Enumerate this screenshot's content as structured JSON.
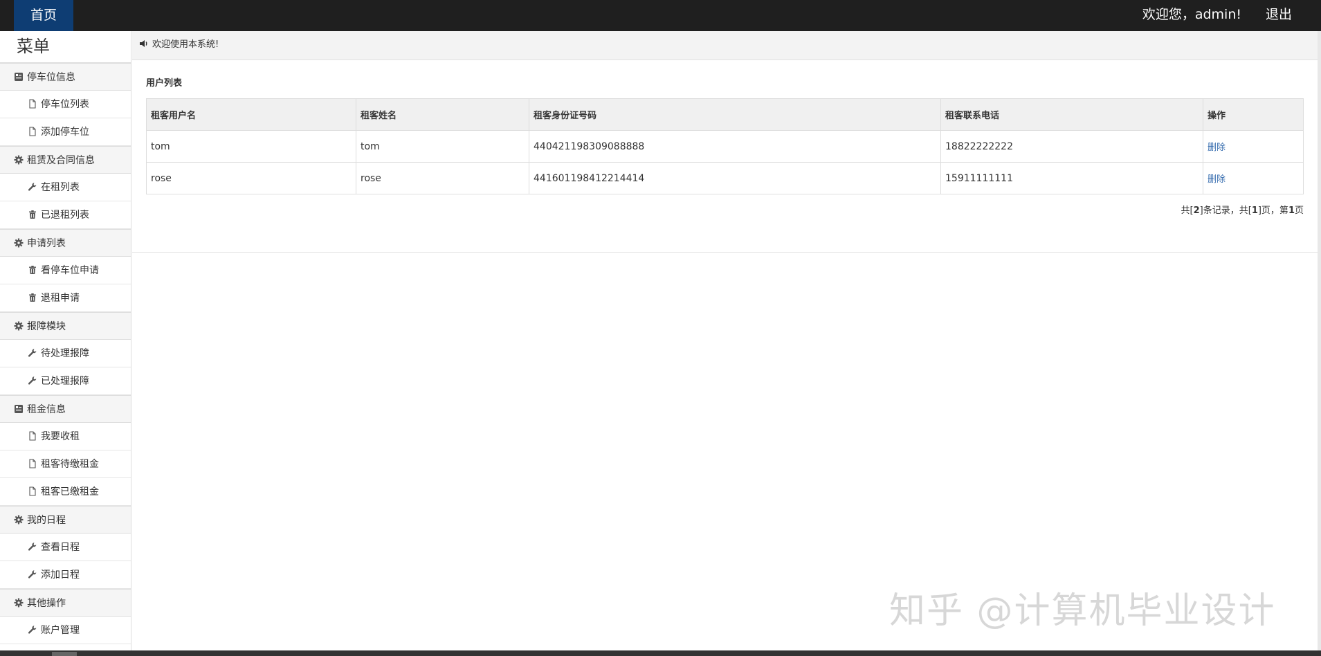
{
  "topbar": {
    "home": "首页",
    "welcome": "欢迎您，admin!",
    "logout": "退出"
  },
  "sidebar": {
    "title": "菜单",
    "groups": [
      {
        "label": "停车位信息",
        "icon": "list-icon",
        "items": [
          {
            "label": "停车位列表",
            "icon": "file-icon"
          },
          {
            "label": "添加停车位",
            "icon": "file-icon"
          }
        ]
      },
      {
        "label": "租赁及合同信息",
        "icon": "gear-icon",
        "items": [
          {
            "label": "在租列表",
            "icon": "wrench-icon"
          },
          {
            "label": "已退租列表",
            "icon": "trash-icon"
          }
        ]
      },
      {
        "label": "申请列表",
        "icon": "gear-icon",
        "items": [
          {
            "label": "看停车位申请",
            "icon": "trash-icon"
          },
          {
            "label": "退租申请",
            "icon": "trash-icon"
          }
        ]
      },
      {
        "label": "报障模块",
        "icon": "gear-icon",
        "items": [
          {
            "label": "待处理报障",
            "icon": "wrench-icon"
          },
          {
            "label": "已处理报障",
            "icon": "wrench-icon"
          }
        ]
      },
      {
        "label": "租金信息",
        "icon": "list-icon",
        "items": [
          {
            "label": "我要收租",
            "icon": "file-icon"
          },
          {
            "label": "租客待缴租金",
            "icon": "file-icon"
          },
          {
            "label": "租客已缴租金",
            "icon": "file-icon"
          }
        ]
      },
      {
        "label": "我的日程",
        "icon": "gear-icon",
        "items": [
          {
            "label": "查看日程",
            "icon": "wrench-icon"
          },
          {
            "label": "添加日程",
            "icon": "wrench-icon"
          }
        ]
      },
      {
        "label": "其他操作",
        "icon": "gear-icon",
        "items": [
          {
            "label": "账户管理",
            "icon": "wrench-icon"
          }
        ]
      }
    ]
  },
  "main": {
    "notice": "欢迎使用本系统!",
    "panel_title": "用户列表",
    "table": {
      "headers": [
        "租客用户名",
        "租客姓名",
        "租客身份证号码",
        "租客联系电话",
        "操作"
      ],
      "rows": [
        {
          "username": "tom",
          "name": "tom",
          "id_number": "440421198309088888",
          "phone": "18822222222",
          "action": "删除"
        },
        {
          "username": "rose",
          "name": "rose",
          "id_number": "441601198412214414",
          "phone": "15911111111",
          "action": "删除"
        }
      ]
    },
    "pager": {
      "prefix": "共[",
      "total": "2",
      "mid1": "]条记录，共[",
      "pages": "1",
      "mid2": "]页，第",
      "current": "1",
      "suffix": "页"
    }
  },
  "watermark": "知乎 @计算机毕业设计"
}
